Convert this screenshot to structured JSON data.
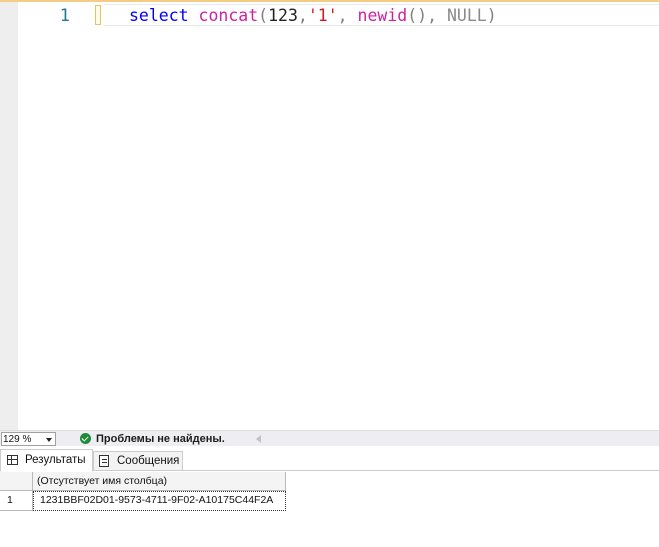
{
  "editor": {
    "line_number": "1",
    "tokens": {
      "kw_select": "select",
      "fn_concat": "concat",
      "num_123": "123",
      "str_1": "'1'",
      "fn_newid": "newid",
      "null_kw": "NULL"
    }
  },
  "statusbar": {
    "zoom": "129 %",
    "status_message": "Проблемы не найдены."
  },
  "results": {
    "tabs": [
      {
        "label": "Результаты",
        "icon": "grid-icon"
      },
      {
        "label": "Сообщения",
        "icon": "messages-icon"
      }
    ],
    "grid": {
      "column_header": "(Отсутствует имя столбца)",
      "row_number": "1",
      "cell_value": "1231BBF02D01-9573-4711-9F02-A10175C44F2A"
    }
  },
  "colors": {
    "keyword": "#0000ff",
    "function": "#d020a0",
    "string": "#c81e1e",
    "status_ok": "#1e8a3c"
  }
}
